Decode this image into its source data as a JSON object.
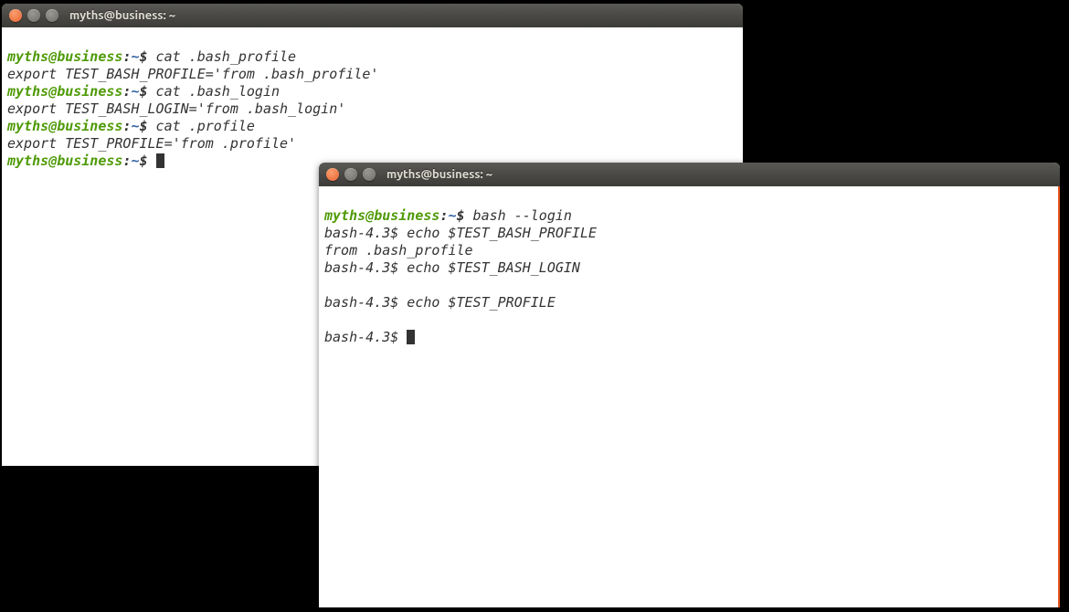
{
  "window1": {
    "title": "myths@business: ~",
    "prompt": {
      "user": "myths",
      "at": "@",
      "host": "business",
      "colon": ":",
      "path": "~",
      "dollar": "$"
    },
    "lines": {
      "cmd1": " cat .bash_profile",
      "out1": "export TEST_BASH_PROFILE='from .bash_profile'",
      "cmd2": " cat .bash_login",
      "out2": "export TEST_BASH_LOGIN='from .bash_login'",
      "cmd3": " cat .profile",
      "out3": "export TEST_PROFILE='from .profile'"
    }
  },
  "window2": {
    "title": "myths@business: ~",
    "prompt": {
      "user": "myths",
      "at": "@",
      "host": "business",
      "colon": ":",
      "path": "~",
      "dollar": "$"
    },
    "subprompt": "bash-4.3$",
    "lines": {
      "cmd1": " bash --login",
      "cmd2": " echo $TEST_BASH_PROFILE",
      "out2": "from .bash_profile",
      "cmd3": " echo $TEST_BASH_LOGIN",
      "out3": "",
      "cmd4": " echo $TEST_PROFILE",
      "out4": ""
    }
  }
}
